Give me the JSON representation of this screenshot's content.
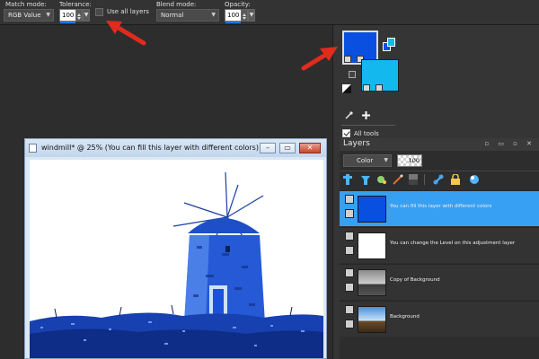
{
  "options_bar": {
    "match_mode": {
      "label": "Match mode:",
      "value": "RGB Value"
    },
    "tolerance": {
      "label": "Tolerance:",
      "value": "100"
    },
    "use_all_layers": {
      "label": "Use all layers",
      "checked": false
    },
    "blend_mode": {
      "label": "Blend mode:",
      "value": "Normal"
    },
    "opacity": {
      "label": "Opacity:",
      "value": "100"
    }
  },
  "colors": {
    "foreground": "#0a50e0",
    "background": "#12b8ee",
    "selection_accent": "#38a0f2",
    "annotation_arrow": "#e02b1d"
  },
  "tools": {
    "icons": [
      "eyedropper-icon",
      "plus-icon"
    ],
    "all_tools_label": "All tools",
    "all_tools_checked": true
  },
  "layers_panel": {
    "title": "Layers",
    "blend": "Color",
    "opacity": "100",
    "toolbar_icons": [
      "new-raster-layer-icon",
      "new-vector-layer-icon",
      "new-art-media-layer-icon",
      "new-mask-layer-icon",
      "new-adjustment-layer-icon",
      "link-icon",
      "lock-icon",
      "layer-style-icon"
    ],
    "layers": [
      {
        "name": "You can fill this layer with different colors",
        "selected": true,
        "thumb": "blue"
      },
      {
        "name": "You can change the Level on this adjustment layer",
        "selected": false,
        "thumb": "white"
      },
      {
        "name": "Copy of Background",
        "selected": false,
        "thumb": "grey-photo"
      },
      {
        "name": "Background",
        "selected": false,
        "thumb": "color-photo"
      }
    ]
  },
  "document": {
    "title": "windmill* @  25% (You can fill this layer with different colors)",
    "buttons": {
      "minimize": "–",
      "maximize": "▭",
      "close": "✕"
    }
  }
}
